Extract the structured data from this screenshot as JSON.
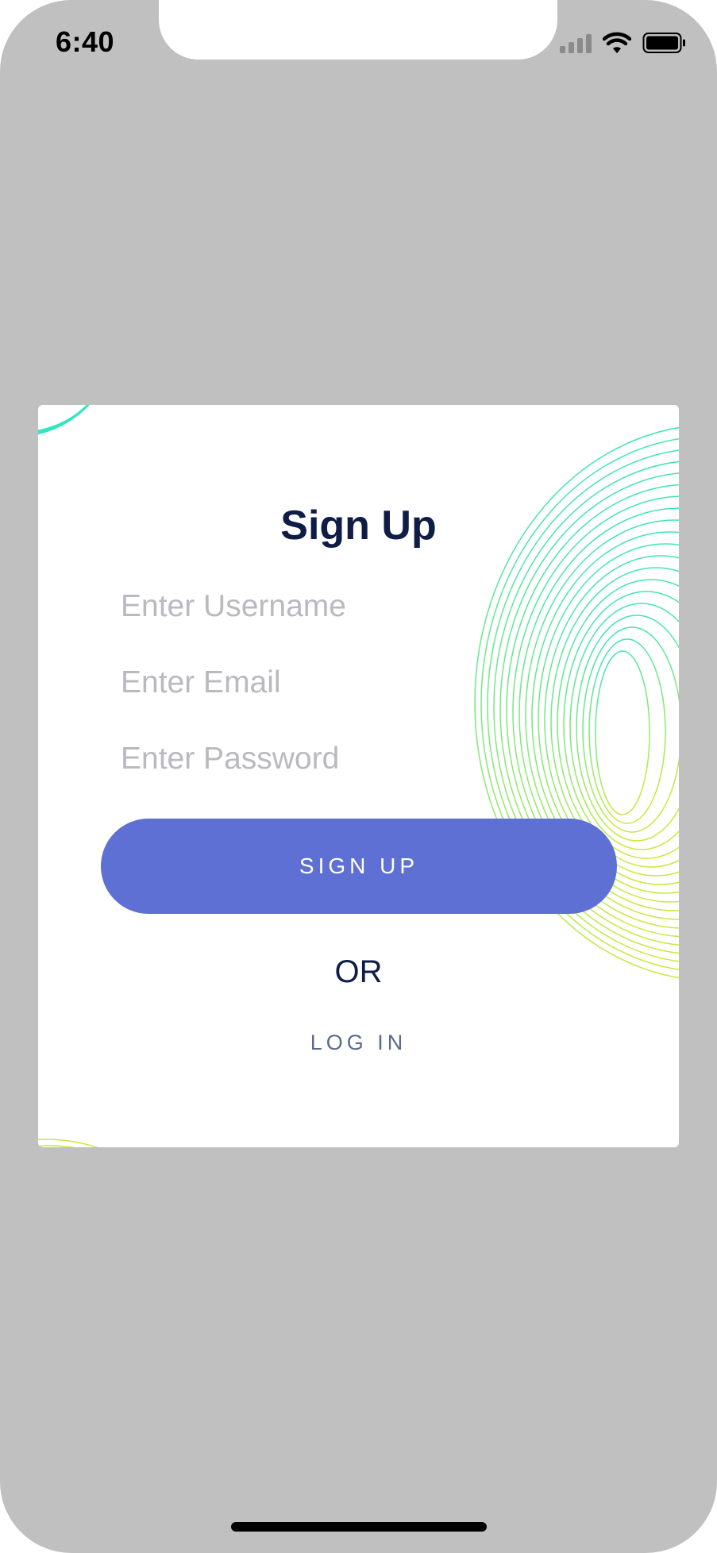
{
  "status_bar": {
    "time": "6:40",
    "icons": [
      "signal-icon",
      "wifi-icon",
      "battery-icon"
    ]
  },
  "card": {
    "title": "Sign Up",
    "username_placeholder": "Enter Username",
    "email_placeholder": "Enter Email",
    "password_placeholder": "Enter Password",
    "signup_button": "SIGN UP",
    "or_text": "OR",
    "login_link": "LOG IN"
  },
  "colors": {
    "background": "#c0c0c0",
    "card": "#ffffff",
    "title": "#0f1c45",
    "button": "#5e70d3",
    "link": "#5c6b8c",
    "placeholder": "#b9b9bf",
    "deco_start": "#2ee6c0",
    "deco_end": "#c6ea3b"
  }
}
